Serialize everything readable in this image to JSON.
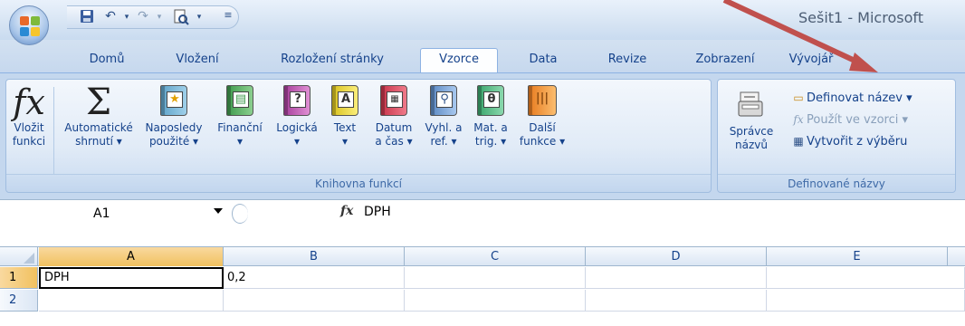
{
  "window": {
    "title": "Sešit1 - Microsoft"
  },
  "quick_access": {
    "icons": [
      "save-icon",
      "undo-icon",
      "redo-icon",
      "print-preview-icon",
      "customize-icon"
    ]
  },
  "tabs": [
    {
      "label": "Domů"
    },
    {
      "label": "Vložení"
    },
    {
      "label": "Rozložení stránky"
    },
    {
      "label": "Vzorce",
      "active": true
    },
    {
      "label": "Data"
    },
    {
      "label": "Revize"
    },
    {
      "label": "Zobrazení"
    },
    {
      "label": "Vývojář"
    }
  ],
  "ribbon": {
    "function_library": {
      "label": "Knihovna funkcí",
      "insert_function": {
        "line1": "Vložit",
        "line2": "funkci"
      },
      "autosum": {
        "line1": "Automatické",
        "line2": "shrnutí ▾"
      },
      "recent": {
        "line1": "Naposledy",
        "line2": "použité ▾"
      },
      "financial": {
        "line1": "Finanční",
        "line2": "▾"
      },
      "logical": {
        "line1": "Logická",
        "line2": "▾"
      },
      "text": {
        "line1": "Text",
        "line2": "▾"
      },
      "datetime": {
        "line1": "Datum",
        "line2": "a čas ▾"
      },
      "lookup": {
        "line1": "Vyhl. a",
        "line2": "ref. ▾"
      },
      "math": {
        "line1": "Mat. a",
        "line2": "trig. ▾"
      },
      "more": {
        "line1": "Další",
        "line2": "funkce ▾"
      }
    },
    "defined_names": {
      "label": "Definované názvy",
      "name_manager": {
        "line1": "Správce",
        "line2": "názvů"
      },
      "define_name": "Definovat název ▾",
      "use_in_formula": "Použít ve vzorci ▾",
      "create_from_selection": "Vytvořit z výběru"
    }
  },
  "formula_bar": {
    "name_box": "A1",
    "fx": "fx",
    "value": "DPH"
  },
  "sheet": {
    "columns": [
      "A",
      "B",
      "C",
      "D",
      "E"
    ],
    "rows": [
      {
        "num": "1",
        "cells": [
          "DPH",
          "0,2",
          "",
          "",
          ""
        ]
      },
      {
        "num": "2",
        "cells": [
          "",
          "",
          "",
          "",
          ""
        ]
      }
    ]
  },
  "colors": {
    "ribbon_bg": "#c4d7ee",
    "tab_text": "#15428b",
    "selected_header": "#f1c15f",
    "annotation_arrow": "#c0504d"
  }
}
